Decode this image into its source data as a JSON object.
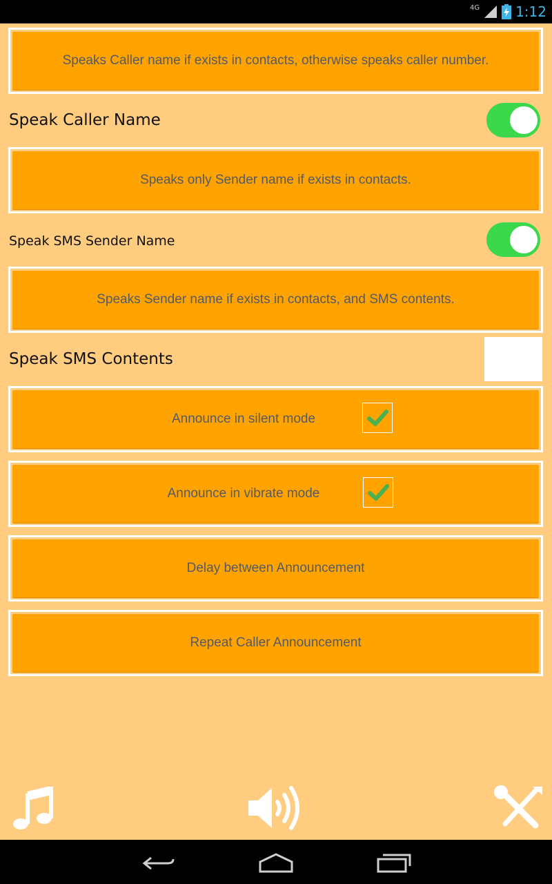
{
  "status_bar": {
    "network": "4G",
    "time": "1:12"
  },
  "cards": {
    "caller_desc": "Speaks Caller name if exists in contacts, otherwise speaks caller number.",
    "sender_desc": "Speaks only Sender name if exists in contacts.",
    "sms_desc": "Speaks Sender name if exists in contacts, and SMS contents.",
    "silent_mode": "Announce in silent mode",
    "vibrate_mode": "Announce in vibrate mode",
    "delay": "Delay between Announcement",
    "repeat": "Repeat Caller Announcement"
  },
  "settings": {
    "speak_caller_name": {
      "label": "Speak Caller Name",
      "enabled": true
    },
    "speak_sms_sender_name": {
      "label": "Speak SMS Sender Name",
      "enabled": true
    },
    "speak_sms_contents": {
      "label": "Speak SMS Contents"
    },
    "silent_mode_checked": true,
    "vibrate_mode_checked": true
  },
  "bottom_icons": [
    "music-icon",
    "speaker-icon",
    "tools-icon"
  ],
  "nav_icons": [
    "back-icon",
    "home-icon",
    "recents-icon"
  ],
  "colors": {
    "background": "#ffcc80",
    "card": "#ffa300",
    "toggle_on": "#3cd84c",
    "check": "#4caf50"
  }
}
